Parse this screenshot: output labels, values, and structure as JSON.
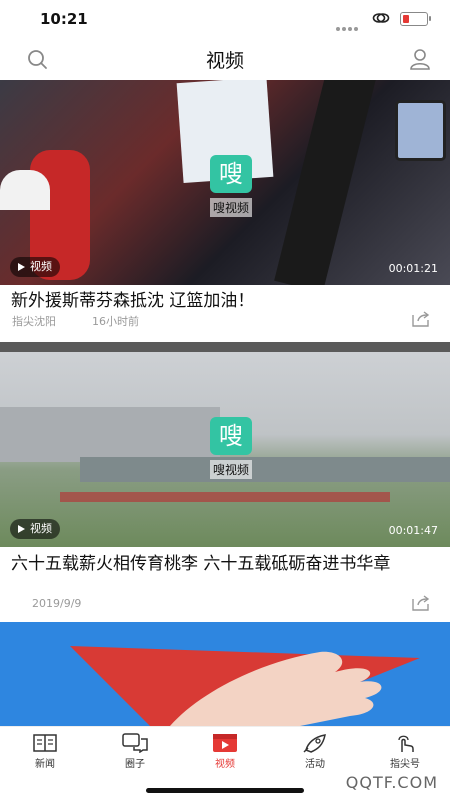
{
  "status_bar": {
    "time": "10:21"
  },
  "header": {
    "title": "视频"
  },
  "feed": [
    {
      "watermark_glyph": "嗖",
      "watermark_label": "嗖视频",
      "badge_label": "视频",
      "duration": "00:01:21",
      "title": "新外援斯蒂芬森抵沈 辽篮加油！",
      "source": "指尖沈阳",
      "time": "16小时前"
    },
    {
      "watermark_glyph": "嗖",
      "watermark_label": "嗖视频",
      "badge_label": "视频",
      "duration": "00:01:47",
      "title": "六十五载薪火相传育桃李 六十五载砥砺奋进书华章",
      "date": "2019/9/9"
    }
  ],
  "tabbar": {
    "items": [
      {
        "label": "新闻",
        "icon": "newspaper-icon"
      },
      {
        "label": "圈子",
        "icon": "chat-icon"
      },
      {
        "label": "视频",
        "icon": "video-icon",
        "active": true
      },
      {
        "label": "活动",
        "icon": "rocket-icon"
      },
      {
        "label": "指尖号",
        "icon": "finger-tap-icon"
      }
    ],
    "active_color": "#e53935"
  },
  "corner_watermark": "QQTF.COM"
}
